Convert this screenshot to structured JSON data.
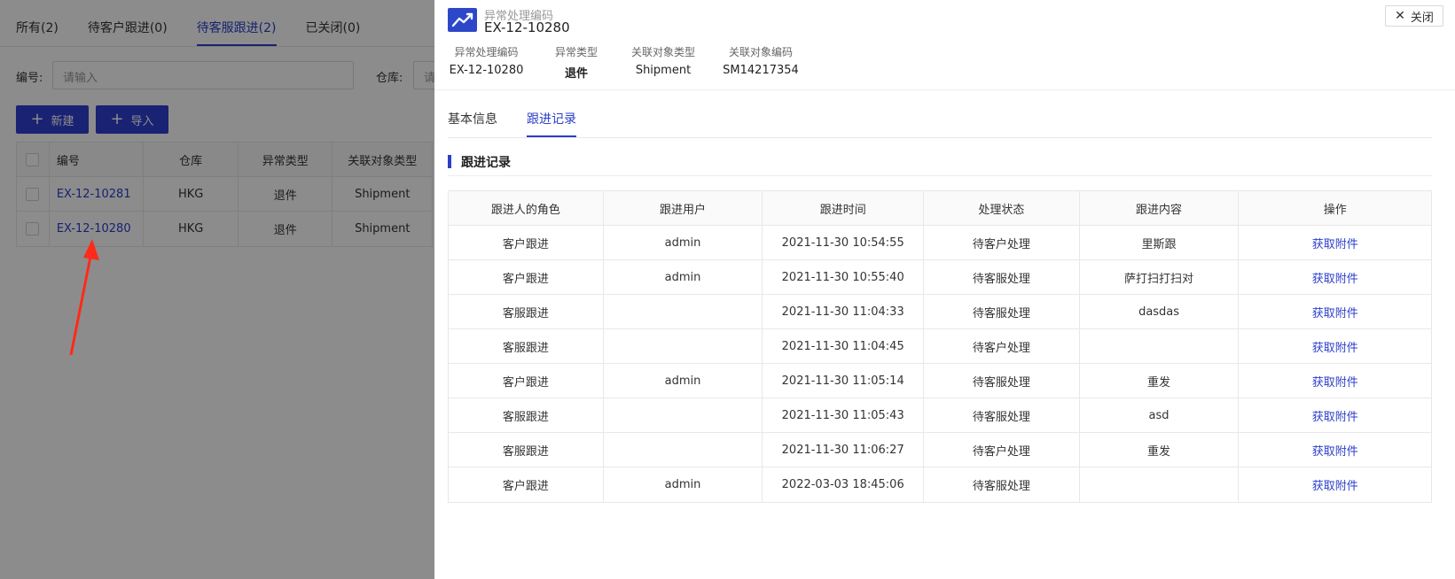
{
  "background": {
    "tabs": [
      {
        "label": "所有(2)"
      },
      {
        "label": "待客户跟进(0)"
      },
      {
        "label": "待客服跟进(2)"
      },
      {
        "label": "已关闭(0)"
      }
    ],
    "filters": {
      "code_label": "编号:",
      "code_placeholder": "请输入",
      "warehouse_label": "仓库:",
      "warehouse_placeholder": "请"
    },
    "buttons": {
      "new_label": "新建",
      "import_label": "导入"
    },
    "table": {
      "headers": [
        "编号",
        "仓库",
        "异常类型",
        "关联对象类型"
      ],
      "rows": [
        {
          "code": "EX-12-10281",
          "warehouse": "HKG",
          "type": "退件",
          "object_type": "Shipment"
        },
        {
          "code": "EX-12-10280",
          "warehouse": "HKG",
          "type": "退件",
          "object_type": "Shipment"
        }
      ]
    }
  },
  "drawer": {
    "subtitle": "异常处理编码",
    "title": "EX-12-10280",
    "close_label": "关闭",
    "summary": [
      {
        "label": "异常处理编码",
        "value": "EX-12-10280"
      },
      {
        "label": "异常类型",
        "value": "退件"
      },
      {
        "label": "关联对象类型",
        "value": "Shipment"
      },
      {
        "label": "关联对象编码",
        "value": "SM14217354"
      }
    ],
    "tabs": [
      {
        "label": "基本信息"
      },
      {
        "label": "跟进记录"
      }
    ],
    "section_title": "跟进记录",
    "records": {
      "headers": [
        "跟进人的角色",
        "跟进用户",
        "跟进时间",
        "处理状态",
        "跟进内容",
        "操作"
      ],
      "rows": [
        {
          "role": "客户跟进",
          "user": "admin",
          "time": "2021-11-30 10:54:55",
          "status": "待客户处理",
          "content": "里斯跟",
          "op": "获取附件"
        },
        {
          "role": "客户跟进",
          "user": "admin",
          "time": "2021-11-30 10:55:40",
          "status": "待客服处理",
          "content": "萨打扫打扫对",
          "op": "获取附件"
        },
        {
          "role": "客服跟进",
          "user": "",
          "time": "2021-11-30 11:04:33",
          "status": "待客服处理",
          "content": "dasdas",
          "op": "获取附件"
        },
        {
          "role": "客服跟进",
          "user": "",
          "time": "2021-11-30 11:04:45",
          "status": "待客户处理",
          "content": "",
          "op": "获取附件"
        },
        {
          "role": "客户跟进",
          "user": "admin",
          "time": "2021-11-30 11:05:14",
          "status": "待客服处理",
          "content": "重发",
          "op": "获取附件"
        },
        {
          "role": "客服跟进",
          "user": "",
          "time": "2021-11-30 11:05:43",
          "status": "待客服处理",
          "content": "asd",
          "op": "获取附件"
        },
        {
          "role": "客服跟进",
          "user": "",
          "time": "2021-11-30 11:06:27",
          "status": "待客户处理",
          "content": "重发",
          "op": "获取附件"
        },
        {
          "role": "客户跟进",
          "user": "admin",
          "time": "2022-03-03 18:45:06",
          "status": "待客服处理",
          "content": "",
          "op": "获取附件"
        }
      ]
    }
  },
  "colors": {
    "accent": "#2b3ec9",
    "button": "#2f3fd1",
    "annotation_arrow": "#ff2a1a"
  },
  "icons": [
    "trend-chart-icon",
    "close-icon",
    "plus-icon",
    "annotation-arrow"
  ]
}
